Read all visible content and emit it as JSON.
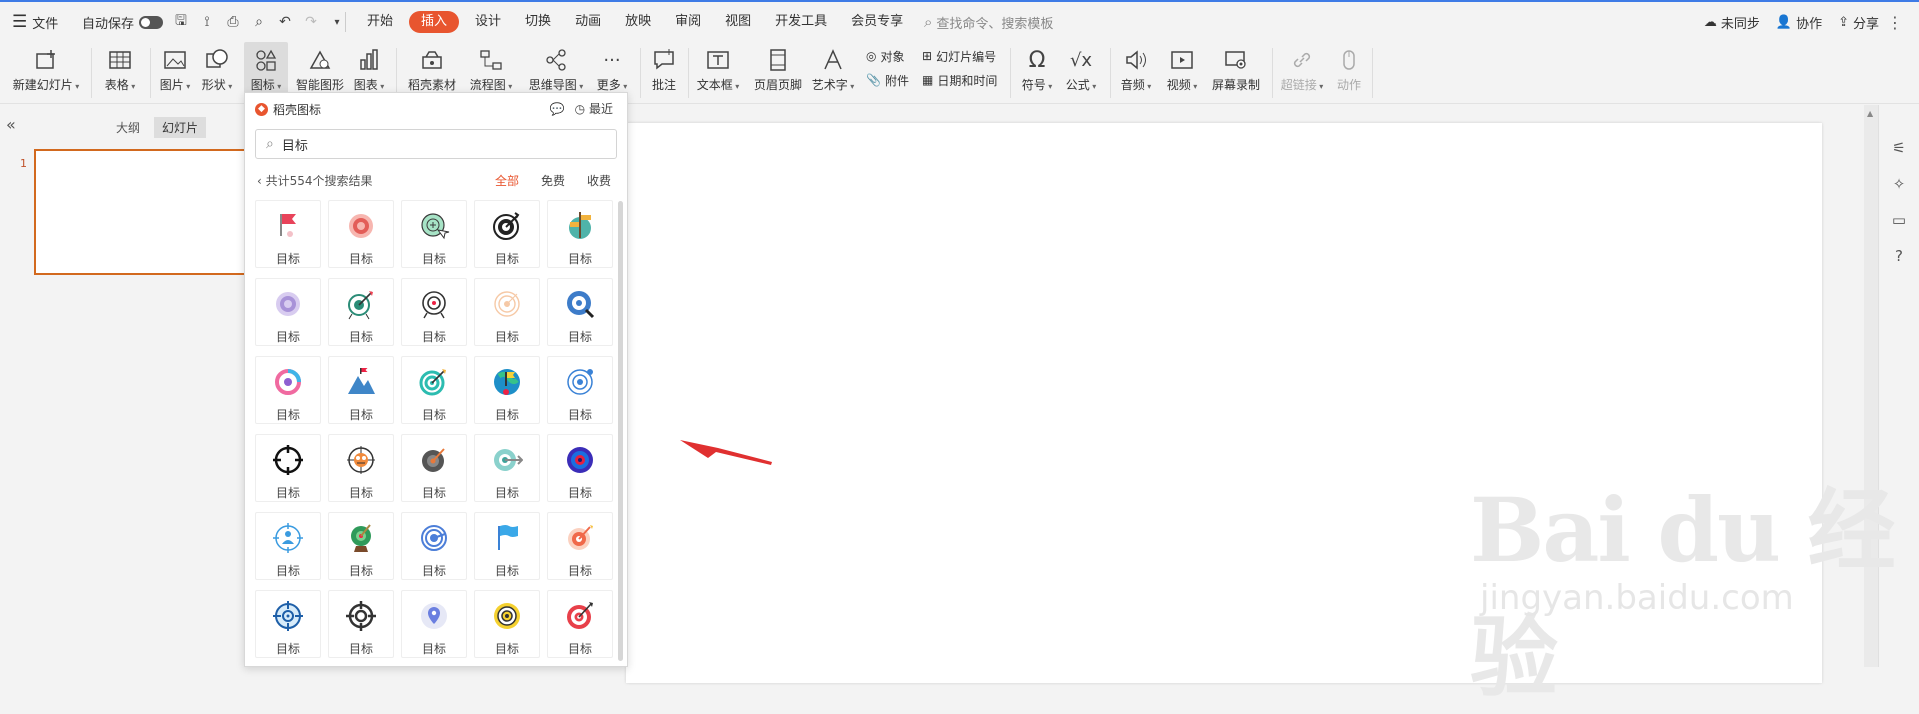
{
  "topbar": {
    "menu_label": "文件",
    "autosave_label": "自动保存",
    "tabs": [
      "开始",
      "插入",
      "设计",
      "切换",
      "动画",
      "放映",
      "审阅",
      "视图",
      "开发工具",
      "会员专享"
    ],
    "active_tab": "插入",
    "search_placeholder": "查找命令、搜索模板",
    "sync_label": "未同步",
    "collab_label": "协作",
    "share_label": "分享"
  },
  "ribbon": {
    "new_slide": "新建幻灯片",
    "table": "表格",
    "picture": "图片",
    "shape": "形状",
    "icon": "图标",
    "smart_shape": "智能图形",
    "chart": "图表",
    "daoke_material": "稻壳素材",
    "flowchart": "流程图",
    "mindmap": "思维导图",
    "more": "更多",
    "comment": "批注",
    "textbox": "文本框",
    "header_footer": "页眉页脚",
    "wordart": "艺术字",
    "object": "对象",
    "attachment": "附件",
    "slide_number": "幻灯片编号",
    "datetime": "日期和时间",
    "symbol": "符号",
    "formula": "公式",
    "audio": "音频",
    "video": "视频",
    "screen_record": "屏幕录制",
    "hyperlink": "超链接",
    "action": "动作"
  },
  "leftpanel": {
    "tab_outline": "大纲",
    "tab_slides": "幻灯片",
    "slide_number": "1"
  },
  "icon_panel": {
    "title": "稻壳图标",
    "recent": "最近",
    "search_value": "目标",
    "result_text": "共计554个搜索结果",
    "filters": [
      "全部",
      "免费",
      "收费"
    ],
    "active_filter": "全部",
    "items": [
      {
        "label": "目标",
        "icon": "red-flag-icon"
      },
      {
        "label": "目标",
        "icon": "red-target-icon"
      },
      {
        "label": "目标",
        "icon": "green-target-cursor-icon"
      },
      {
        "label": "目标",
        "icon": "black-dart-target-icon"
      },
      {
        "label": "目标",
        "icon": "signpost-globe-icon"
      },
      {
        "label": "目标",
        "icon": "purple-target-icon"
      },
      {
        "label": "目标",
        "icon": "green-dart-target-icon"
      },
      {
        "label": "目标",
        "icon": "outline-target-icon"
      },
      {
        "label": "目标",
        "icon": "peach-target-icon"
      },
      {
        "label": "目标",
        "icon": "blue-magnifier-target-icon"
      },
      {
        "label": "目标",
        "icon": "colorful-ring-icon"
      },
      {
        "label": "目标",
        "icon": "mountain-flag-icon"
      },
      {
        "label": "目标",
        "icon": "teal-dart-target-icon"
      },
      {
        "label": "目标",
        "icon": "globe-flag-icon"
      },
      {
        "label": "目标",
        "icon": "blue-ring-target-icon"
      },
      {
        "label": "目标",
        "icon": "crosshair-icon"
      },
      {
        "label": "目标",
        "icon": "bird-target-icon"
      },
      {
        "label": "目标",
        "icon": "gray-dart-target-icon"
      },
      {
        "label": "目标",
        "icon": "teal-arrow-target-icon"
      },
      {
        "label": "目标",
        "icon": "navy-red-target-icon"
      },
      {
        "label": "目标",
        "icon": "person-target-icon"
      },
      {
        "label": "目标",
        "icon": "green-trophy-target-icon"
      },
      {
        "label": "目标",
        "icon": "blue-spiral-target-icon"
      },
      {
        "label": "目标",
        "icon": "blue-flag-icon"
      },
      {
        "label": "目标",
        "icon": "orange-dart-target-icon"
      },
      {
        "label": "目标",
        "icon": "blue-crosshair-icon"
      },
      {
        "label": "目标",
        "icon": "dark-crosshair-icon"
      },
      {
        "label": "目标",
        "icon": "location-pin-icon"
      },
      {
        "label": "目标",
        "icon": "yellow-target-icon"
      },
      {
        "label": "目标",
        "icon": "red-arrow-target-icon"
      }
    ]
  },
  "watermark": {
    "brand": "Bai du 经验",
    "domain": "jingyan.baidu.com"
  },
  "colors": {
    "accent": "#e8552f",
    "thumb_border": "#d2691e",
    "arrow": "#e03030"
  }
}
